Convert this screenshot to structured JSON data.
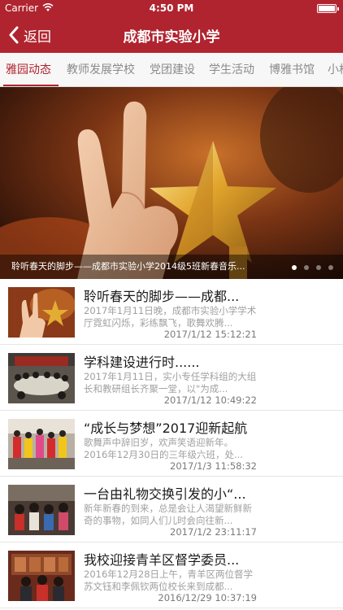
{
  "status": {
    "carrier": "Carrier",
    "time": "4:50 PM"
  },
  "nav": {
    "back_label": "返回",
    "title": "成都市实验小学"
  },
  "tabs": [
    {
      "label": "雅园动态",
      "active": true
    },
    {
      "label": "教师发展学校",
      "active": false
    },
    {
      "label": "党团建设",
      "active": false
    },
    {
      "label": "学生活动",
      "active": false
    },
    {
      "label": "博雅书馆",
      "active": false
    },
    {
      "label": "小棉",
      "active": false
    }
  ],
  "banner": {
    "caption": "聆听春天的脚步——成都市实验小学2014级5班新春音乐...",
    "pages": 4,
    "current_page": 1
  },
  "news": [
    {
      "title": "聆听春天的脚步——成都...",
      "desc": "2017年1月11日晚，成都市实验小学学术厅霓虹闪烁，彩练飘飞，歌舞欢腾...",
      "date": "2017/1/12 15:12:21"
    },
    {
      "title": "学科建设进行时......",
      "desc": "2017年1月11日，实小专任学科组的大组长和教研组长齐聚一堂，以\"为成...",
      "date": "2017/1/12 10:49:22"
    },
    {
      "title": "“成长与梦想”2017迎新起航",
      "desc": "歌舞声中辞旧岁，欢声笑语迎新年。2016年12月30日的三年级六班，处...",
      "date": "2017/1/3 11:58:32"
    },
    {
      "title": "一台由礼物交换引发的小“...",
      "desc": "新年新春的到来，总是会让人渴望新鲜新奇的事物，如同人们儿时会向往新...",
      "date": "2017/1/2 23:11:17"
    },
    {
      "title": "我校迎接青羊区督学委员...",
      "desc": "2016年12月28日上午，青羊区两位督学苏文钰和李佩钦两位校长来到成都...",
      "date": "2016/12/29 10:37:19"
    }
  ],
  "colors": {
    "brand": "#b0242f",
    "tab_bg": "#f7f7f7"
  }
}
